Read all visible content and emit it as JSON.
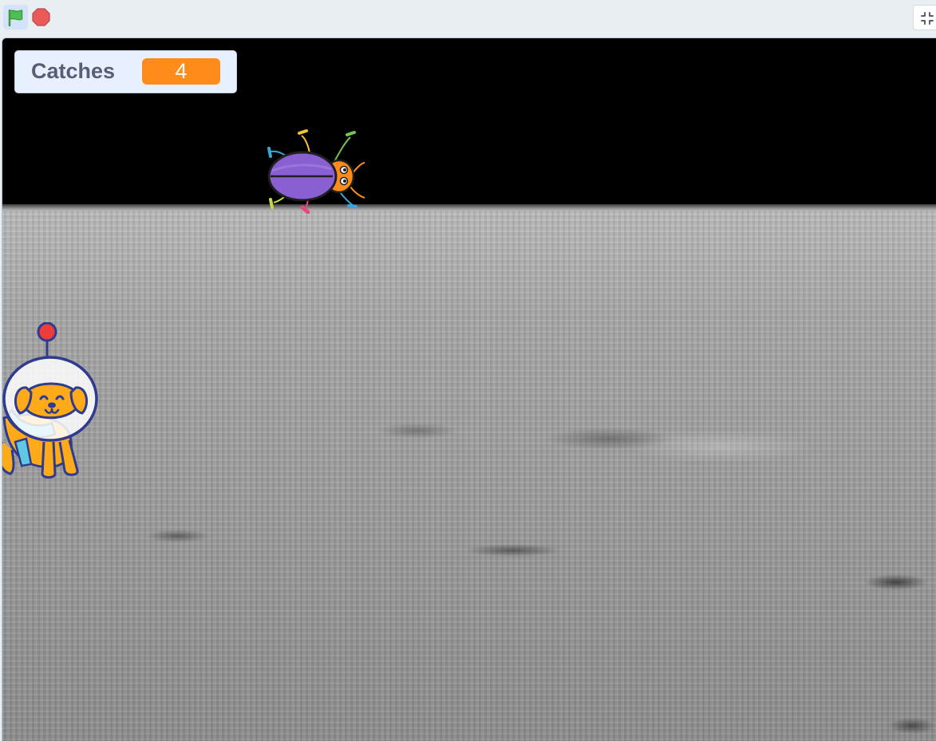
{
  "toolbar": {
    "green_flag_icon": "green-flag-icon",
    "stop_icon": "stop-sign-icon",
    "fullscreen_icon": "unfullscreen-icon"
  },
  "stage": {
    "monitor": {
      "label": "Catches",
      "value": "4"
    },
    "sprites": [
      {
        "name": "beetle",
        "icon": "beetle-sprite"
      },
      {
        "name": "space-dog",
        "icon": "space-dog-sprite"
      }
    ],
    "backdrop": "moon-surface"
  },
  "colors": {
    "monitor_value_bg": "#ff8c1a",
    "monitor_bg": "#e6f0ff",
    "label_color": "#575e75",
    "flag_green": "#4cbf56",
    "stop_red": "#ec5959"
  }
}
